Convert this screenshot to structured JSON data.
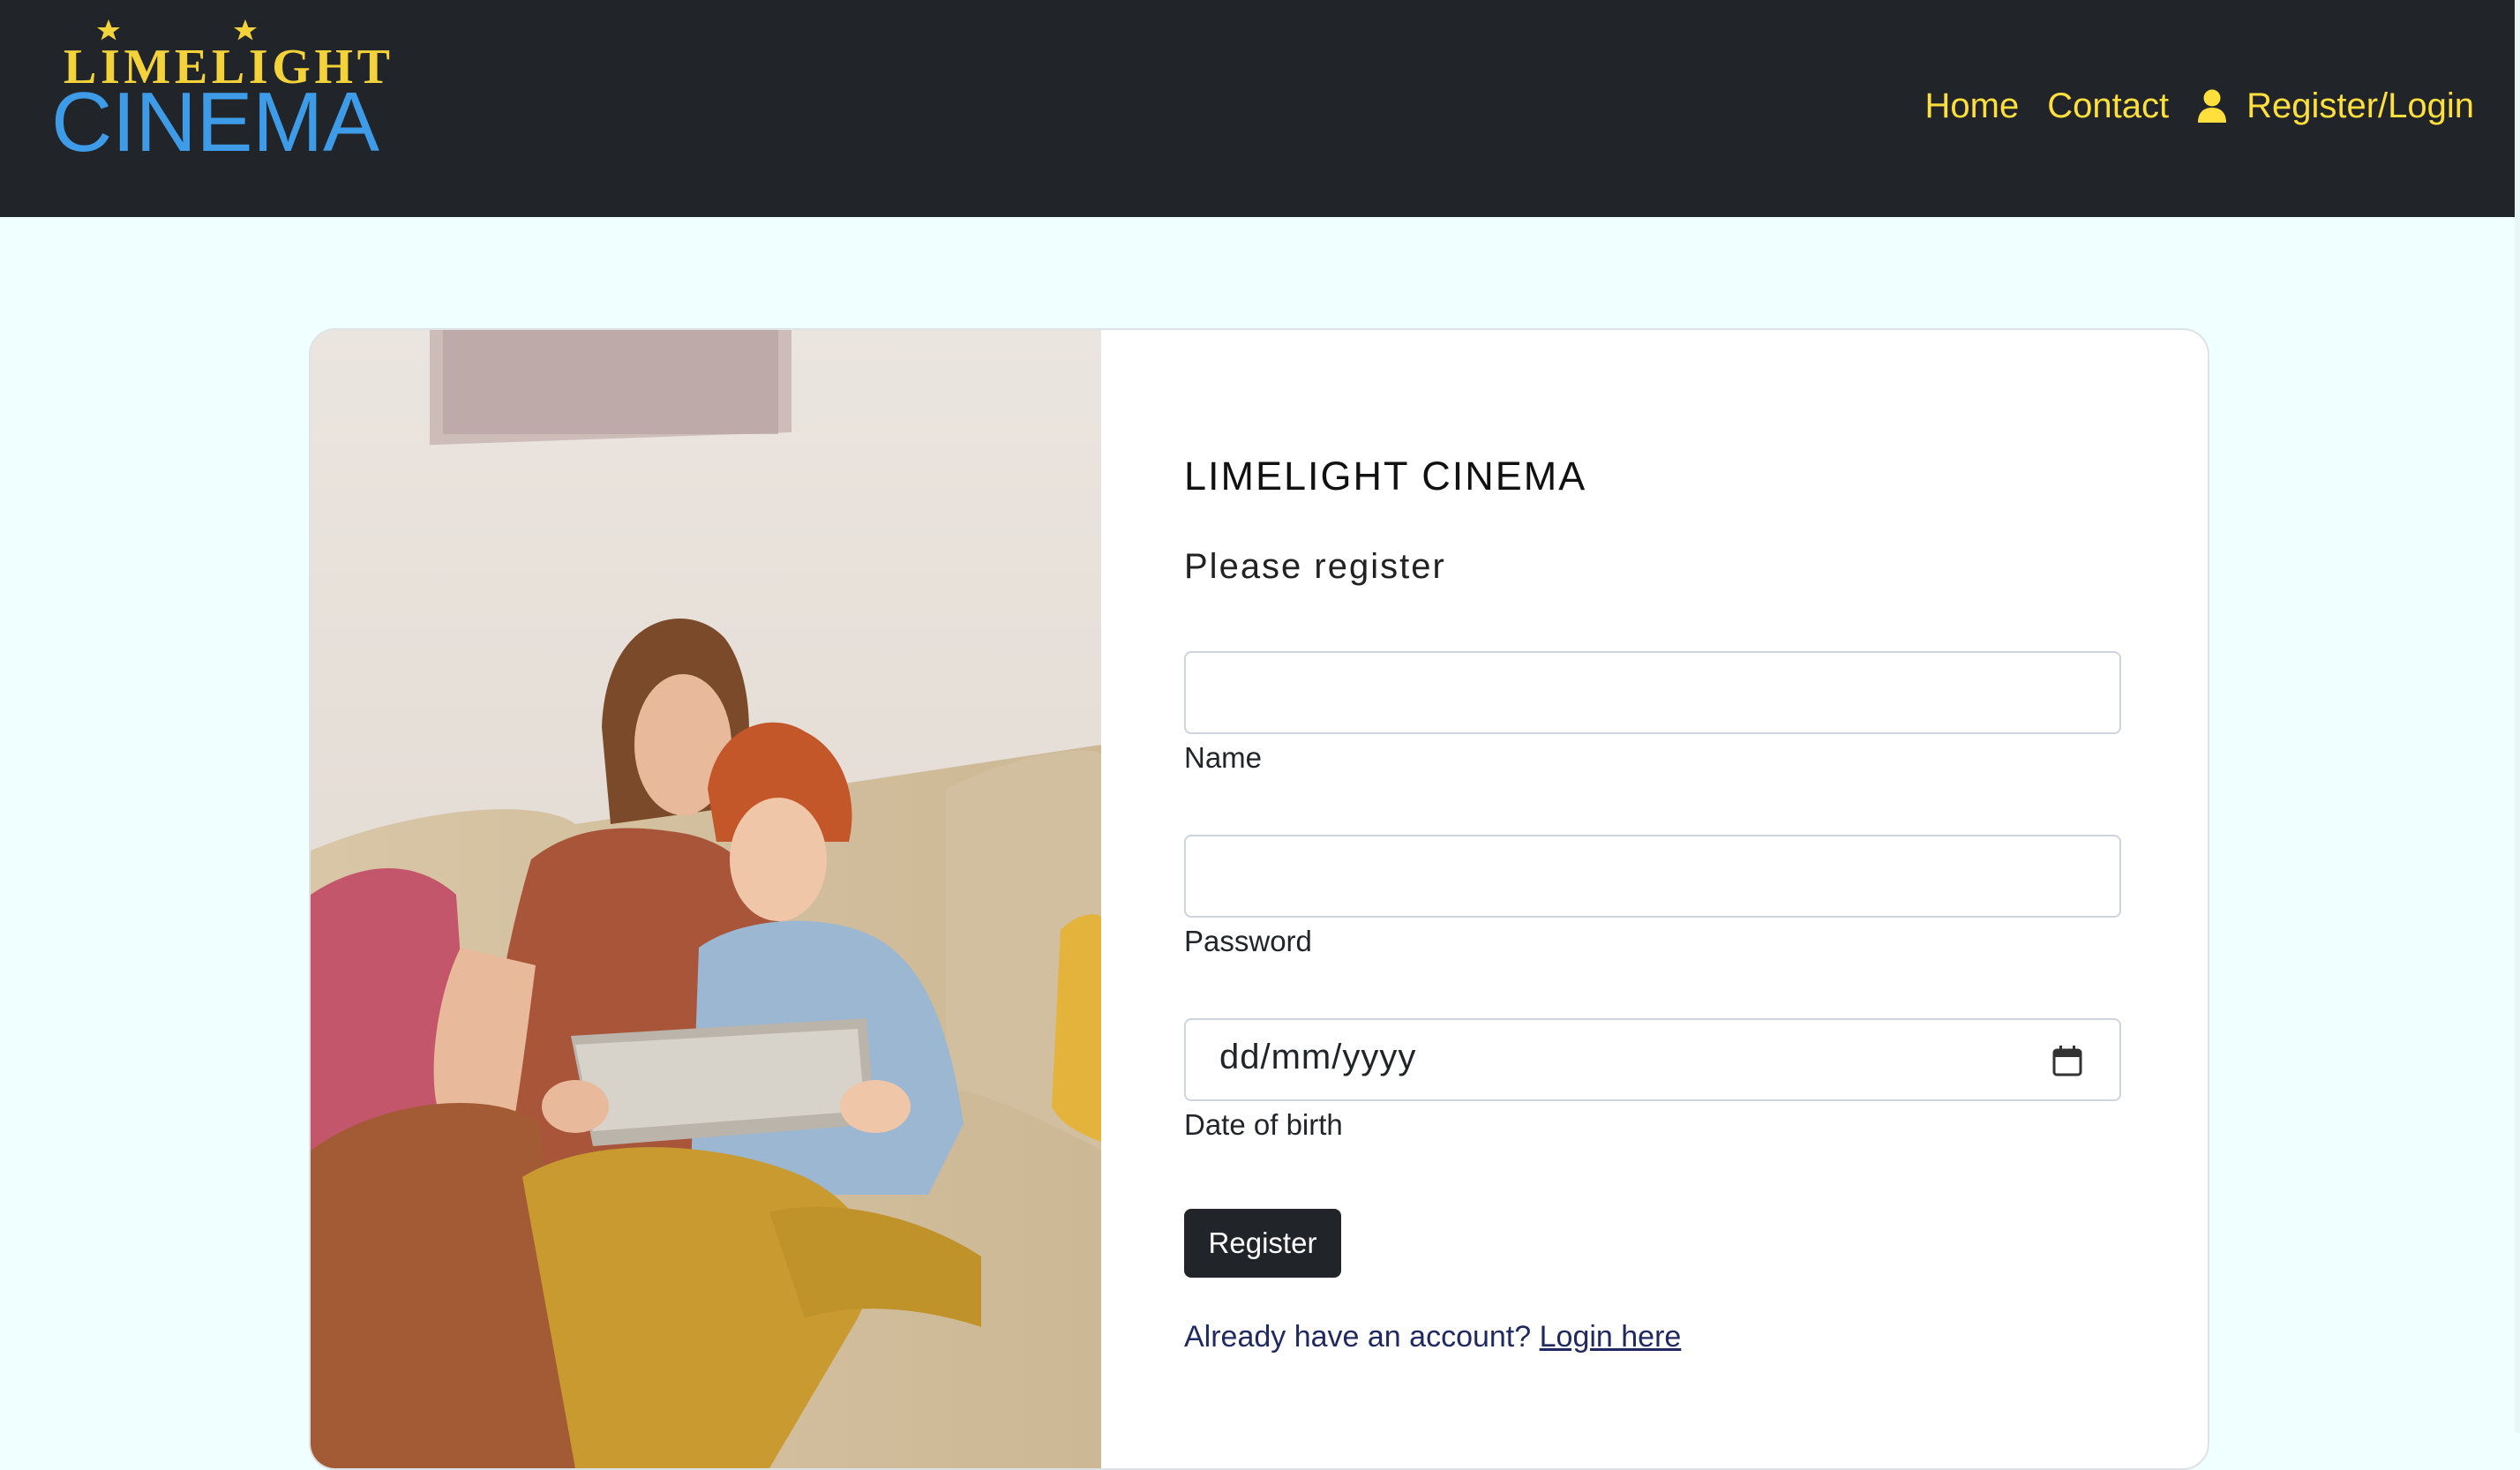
{
  "header": {
    "logo": {
      "line1": "LIMELIGHT",
      "line2": "CINEMA",
      "line1_color": "#f4d23a",
      "line2_color": "#3e9be8"
    },
    "nav": {
      "home": "Home",
      "contact": "Contact",
      "login": "Register/Login",
      "login_icon": "user-icon"
    },
    "background": "#212529",
    "link_color": "#ffdf3c"
  },
  "page": {
    "background": "#f0ffff"
  },
  "form": {
    "title": "LIMELIGHT CINEMA",
    "subtitle": "Please register",
    "fields": {
      "name": {
        "label": "Name",
        "value": ""
      },
      "password": {
        "label": "Password",
        "value": ""
      },
      "dob": {
        "label": "Date of birth",
        "value": "dd/mm/yyyy",
        "icon": "calendar-icon"
      }
    },
    "submit_label": "Register",
    "account_prompt": "Already have an account?",
    "login_link": "Login here"
  }
}
